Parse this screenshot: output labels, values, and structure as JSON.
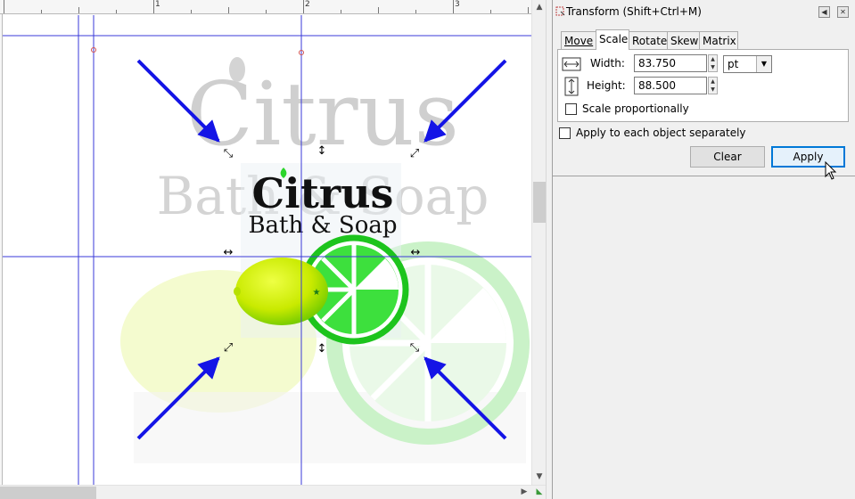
{
  "ruler": {
    "labels": [
      "1",
      "2",
      "3"
    ]
  },
  "canvas": {
    "logo_word": "Citrus",
    "logo_sub": "Bath & Soap"
  },
  "dialog": {
    "title": "Transform (Shift+Ctrl+M)",
    "tabs": [
      "Move",
      "Scale",
      "Rotate",
      "Skew",
      "Matrix"
    ],
    "active_tab": "Scale",
    "width_label": "Width:",
    "width_value": "83.750",
    "height_label": "Height:",
    "height_value": "88.500",
    "unit": "pt",
    "scale_proportionally_label": "Scale proportionally",
    "scale_proportionally_checked": false,
    "apply_each_label": "Apply to each object separately",
    "apply_each_checked": false,
    "clear_label": "Clear",
    "apply_label": "Apply"
  },
  "colors": {
    "guide": "#3a3ad8",
    "arrow": "#1414e6",
    "lime_green": "#2bd52b",
    "lemon": "#d4f000",
    "focus_blue": "#0078d7"
  }
}
